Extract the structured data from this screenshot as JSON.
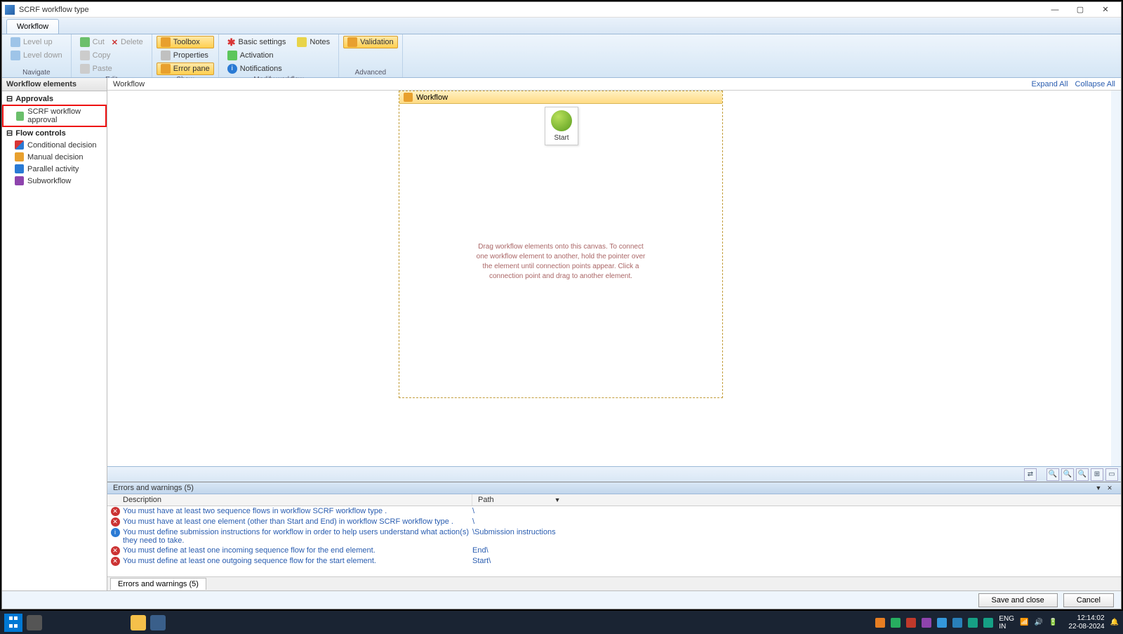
{
  "window": {
    "title": "SCRF workflow type"
  },
  "ribbon": {
    "tab": "Workflow",
    "groups": {
      "navigate": {
        "label": "Navigate",
        "level_up": "Level up",
        "level_down": "Level down"
      },
      "edit": {
        "label": "Edit",
        "cut": "Cut",
        "delete": "Delete",
        "copy": "Copy",
        "paste": "Paste"
      },
      "show": {
        "label": "Show",
        "toolbox": "Toolbox",
        "properties": "Properties",
        "error_pane": "Error pane"
      },
      "modify": {
        "label": "Modify workflow",
        "basic": "Basic settings",
        "notes": "Notes",
        "activation": "Activation",
        "notifications": "Notifications"
      },
      "advanced": {
        "label": "Advanced",
        "validation": "Validation"
      }
    }
  },
  "left_panel": {
    "header": "Workflow elements",
    "approvals_group": "Approvals",
    "approval_item": "SCRF workflow approval",
    "flow_group": "Flow controls",
    "items": {
      "conditional": "Conditional decision",
      "manual": "Manual decision",
      "parallel": "Parallel activity",
      "subworkflow": "Subworkflow"
    }
  },
  "main": {
    "breadcrumb": "Workflow",
    "expand_all": "Expand All",
    "collapse_all": "Collapse All",
    "workflow_box_title": "Workflow",
    "start_label": "Start",
    "hint": "Drag workflow elements onto this canvas. To connect one workflow element to another, hold the pointer over the element until connection points appear.  Click a connection point and drag to another element."
  },
  "errors": {
    "title": "Errors and warnings (5)",
    "tab": "Errors and warnings (5)",
    "col_description": "Description",
    "col_path": "Path",
    "rows": [
      {
        "type": "error",
        "desc": "You must have at least two sequence flows in workflow SCRF workflow type .",
        "path": "\\"
      },
      {
        "type": "error",
        "desc": "You must have at least one element (other than Start and End) in workflow SCRF workflow type .",
        "path": "\\"
      },
      {
        "type": "info",
        "desc": "You must define submission instructions for workflow  in order to help users understand what action(s) they need to take.",
        "path": "\\Submission instructions"
      },
      {
        "type": "error",
        "desc": "You must define at least one incoming sequence flow for the end element.",
        "path": "End\\"
      },
      {
        "type": "error",
        "desc": "You must define at least one outgoing sequence flow for the start element.",
        "path": "Start\\"
      }
    ]
  },
  "footer": {
    "save": "Save and close",
    "cancel": "Cancel"
  },
  "taskbar": {
    "lang1": "ENG",
    "lang2": "IN",
    "time": "12:14:02",
    "date": "22-08-2024"
  }
}
